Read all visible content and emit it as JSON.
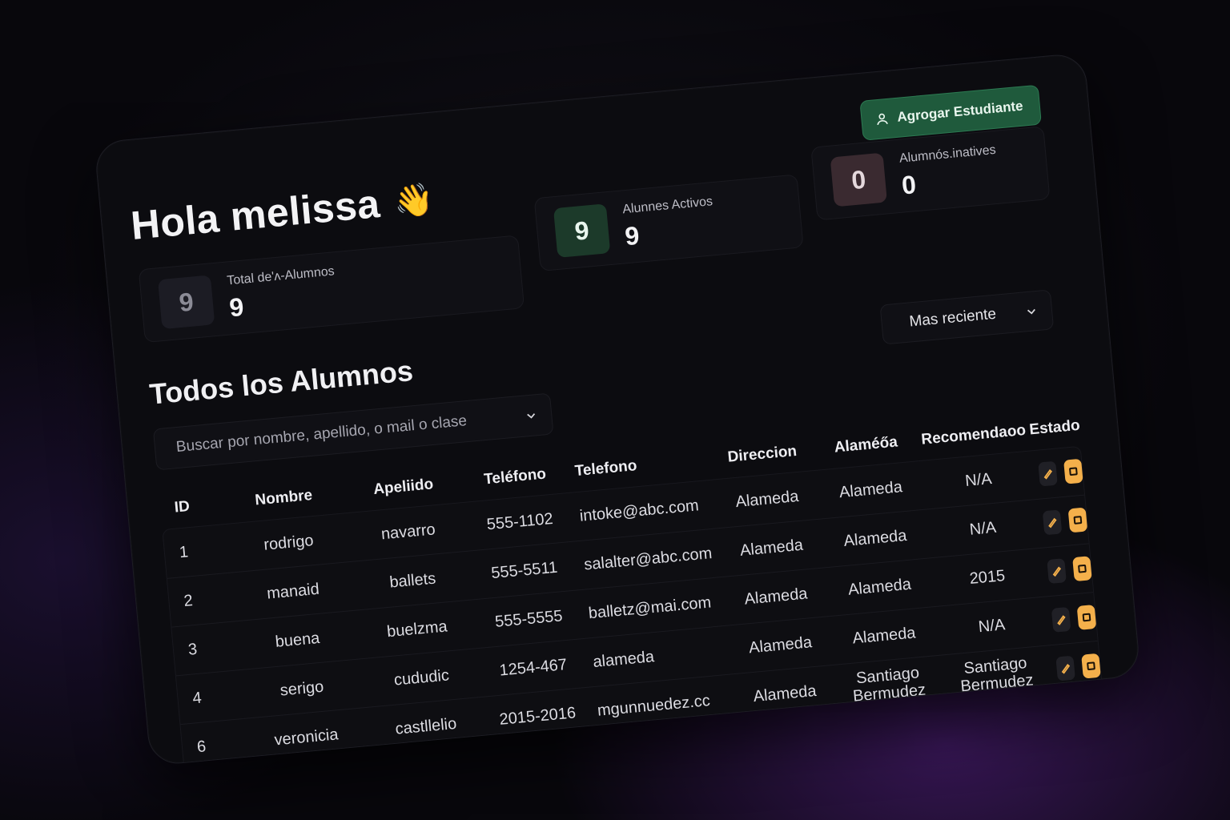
{
  "header": {
    "greeting": "Hola melissa",
    "wave_icon": "waving-hand-icon",
    "add_button_label": "Agrogar Estudiante"
  },
  "stats": {
    "total": {
      "badge": "9",
      "label": "Total de'ʌ-Alumnos",
      "value": "9"
    },
    "active": {
      "badge": "9",
      "label": "Alunnes Activos",
      "value": "9"
    },
    "inactive": {
      "badge": "0",
      "label": "Alumnós.inatives",
      "value": "0"
    }
  },
  "list": {
    "title": "Todos los Alumnos",
    "search_placeholder": "Buscar por nombre, apellido, o mail o clase",
    "sort_selected": "Mas reciente"
  },
  "table": {
    "headers": {
      "id": "ID",
      "nombre": "Nombre",
      "apellido": "Apeliido",
      "tel1": "Teléfono",
      "tel2": "Telefono",
      "dir": "Direccion",
      "alam": "Alaméőa",
      "rec": "Recomendaoo",
      "est": "Estado"
    },
    "rows": [
      {
        "id": "1",
        "nombre": "rodrigo",
        "apellido": "navarro",
        "tel1": "555-1102",
        "tel2": "intoke@abc.com",
        "dir": "Alameda",
        "alam": "Alameda",
        "rec": "N/A"
      },
      {
        "id": "2",
        "nombre": "manaid",
        "apellido": "ballets",
        "tel1": "555-5511",
        "tel2": "salalter@abc.com",
        "dir": "Alameda",
        "alam": "Alameda",
        "rec": "N/A"
      },
      {
        "id": "3",
        "nombre": "buena",
        "apellido": "buelzma",
        "tel1": "555-5555",
        "tel2": "balletz@mai.com",
        "dir": "Alameda",
        "alam": "Alameda",
        "rec": "2015"
      },
      {
        "id": "4",
        "nombre": "serigo",
        "apellido": "cududic",
        "tel1": "1254-467",
        "tel2": "alameda",
        "dir": "Alameda",
        "alam": "Alameda",
        "rec": "N/A"
      },
      {
        "id": "6",
        "nombre": "veronicia",
        "apellido": "castllelio",
        "tel1": "2015-2016",
        "tel2": "mgunnuedez.cc",
        "dir": "Alameda",
        "alam": "Santiago Bermudez",
        "rec": "Santiago Bermudez"
      }
    ]
  },
  "colors": {
    "accent_green": "#1f5a3c",
    "action_orange": "#f4b04b",
    "card_bg": "#0c0c10"
  }
}
